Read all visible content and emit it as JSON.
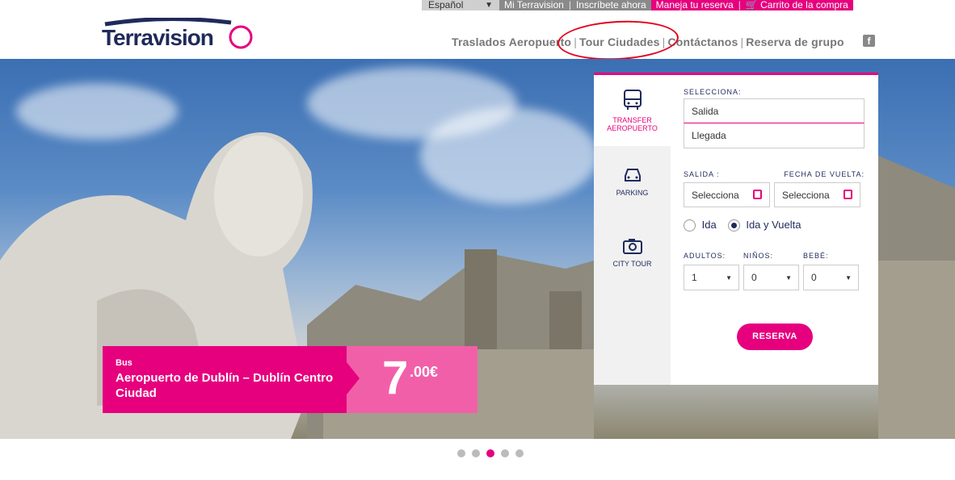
{
  "topbar": {
    "language": "Español",
    "language_arrow": "▼",
    "mi_terravision": "Mi Terravision",
    "inscribete": "Inscríbete ahora",
    "maneja": "Maneja tu reserva",
    "carrito": "Carrito de la compra",
    "separator": "|"
  },
  "brand": {
    "logo_text": "Terravision",
    "primary_color": "#1f2a5a",
    "accent_color": "#e6007e"
  },
  "nav": {
    "items": [
      {
        "label": "Traslados Aeropuerto"
      },
      {
        "label": "Tour Ciudades"
      },
      {
        "label": "Contáctanos"
      },
      {
        "label": "Reserva de grupo"
      }
    ],
    "separator": "|",
    "facebook": "f"
  },
  "booking": {
    "tabs": [
      {
        "label": "TRANSFER AEROPUERTO",
        "icon": "bus-icon"
      },
      {
        "label": "PARKING",
        "icon": "car-icon"
      },
      {
        "label": "CITY TOUR",
        "icon": "camera-icon"
      }
    ],
    "selecciona_label": "SELECCIONA:",
    "salida_placeholder": "Salida",
    "llegada_placeholder": "Llegada",
    "salida_date_label": "SALIDA :",
    "vuelta_date_label": "FECHA DE VUELTA:",
    "date_placeholder": "Selecciona",
    "radio_ida": "Ida",
    "radio_ida_vuelta": "Ida y Vuelta",
    "adultos_label": "ADULTOS:",
    "ninos_label": "NIÑOS:",
    "bebe_label": "BEBÉ:",
    "adultos_value": "1",
    "ninos_value": "0",
    "bebe_value": "0",
    "dropdown_arrow": "▼",
    "submit": "RESERVA"
  },
  "promo": {
    "type": "Bus",
    "title": "Aeropuerto de Dublín – Dublín Centro Ciudad",
    "price_integer": "7",
    "price_decimal": ".00€"
  },
  "slider": {
    "count": 5,
    "active_index": 2
  }
}
